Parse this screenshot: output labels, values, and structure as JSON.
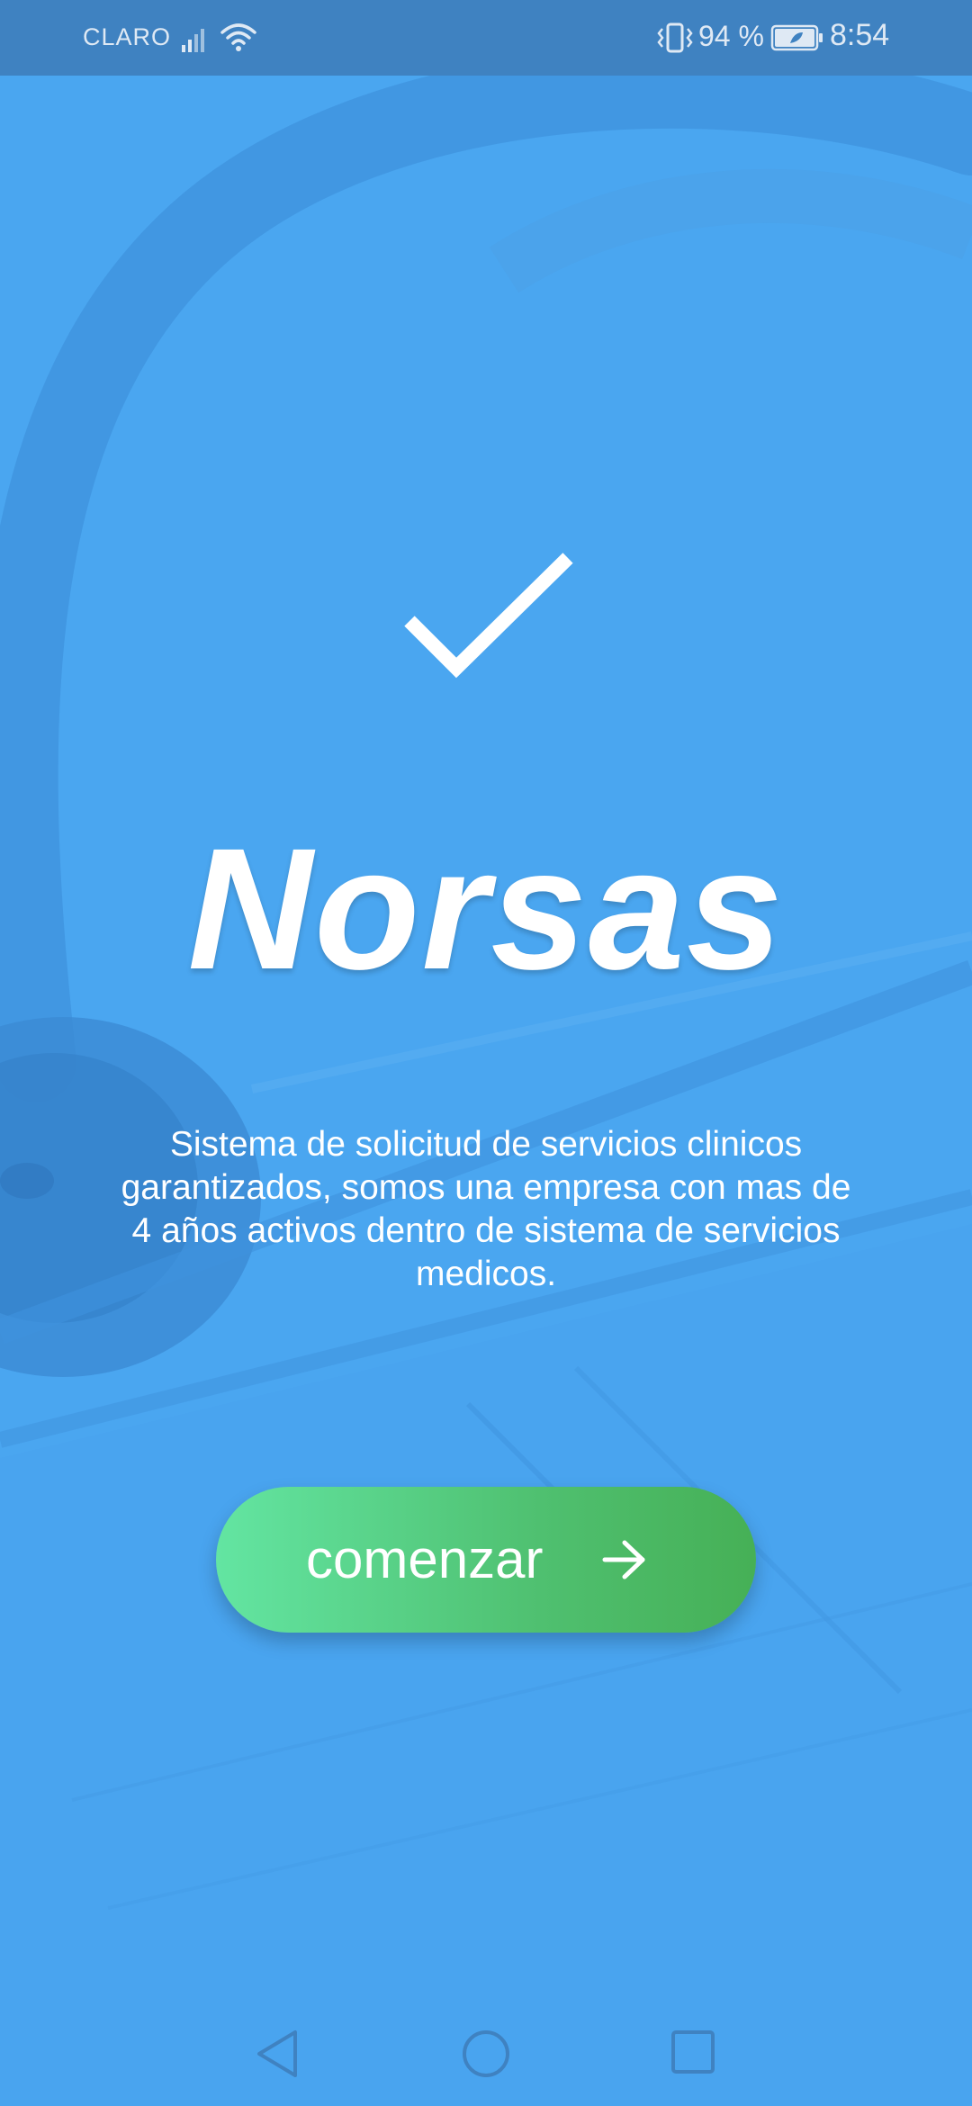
{
  "status_bar": {
    "carrier": "CLARO",
    "battery_percent": "94 %",
    "time": "8:54",
    "icons": [
      "signal-icon",
      "wifi-icon",
      "vibrate-icon",
      "battery-icon"
    ]
  },
  "main": {
    "logo_icon": "check-icon",
    "title": "Norsas",
    "description": "Sistema de solicitud de servicios clinicos garantizados, somos una empresa con mas de 4 años activos dentro de sistema de servicios medicos.",
    "start_button": {
      "label": "comenzar",
      "icon": "arrow-right-icon"
    }
  },
  "nav_bar": {
    "icons": [
      "nav-back-icon",
      "nav-home-icon",
      "nav-recents-icon"
    ]
  },
  "colors": {
    "background_overlay": "#4aa6f0",
    "status_bar": "#3f82c1",
    "button_gradient_start": "#63e5a2",
    "button_gradient_end": "#46b056",
    "text": "#ffffff"
  }
}
